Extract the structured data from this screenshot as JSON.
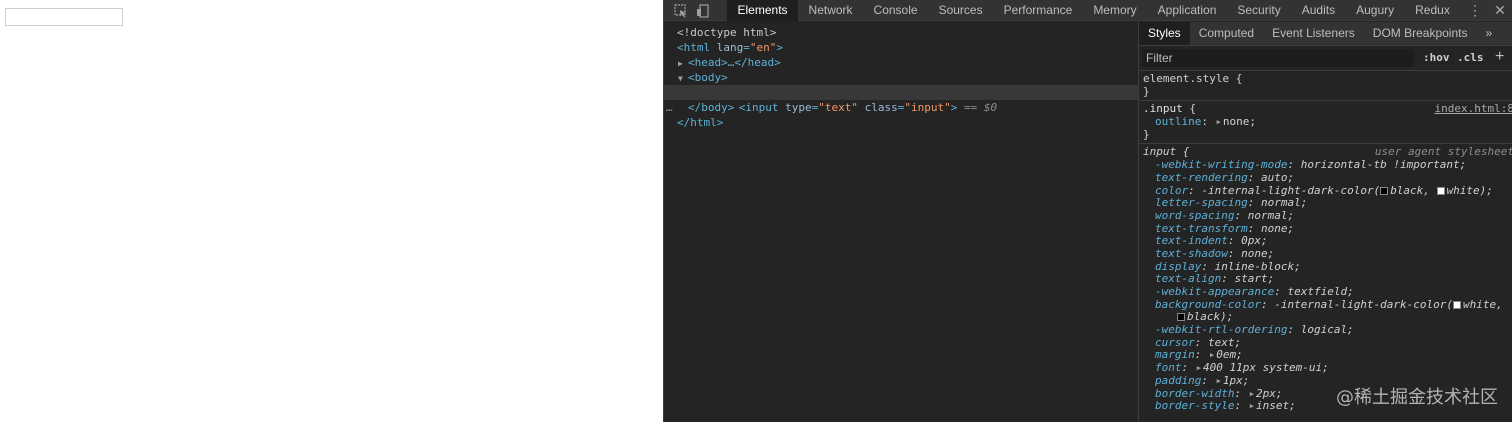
{
  "page": {
    "input_value": ""
  },
  "devtools": {
    "tabs": [
      "Elements",
      "Network",
      "Console",
      "Sources",
      "Performance",
      "Memory",
      "Application",
      "Security",
      "Audits",
      "Augury",
      "Redux"
    ],
    "active_tab": "Elements",
    "icons": {
      "inspect": "cursor-select-icon",
      "device": "device-toolbar-icon",
      "more": "kebab-menu-icon",
      "close": "close-icon"
    },
    "tree": {
      "doctype": "<!doctype html>",
      "html_open": "<html",
      "html_attr": "lang",
      "html_attr_val": "\"en\"",
      "head": "<head>…</head>",
      "body_open": "<body>",
      "input_tag": "<input",
      "input_type_attr": "type",
      "input_type_val": "\"text\"",
      "input_class_attr": "class",
      "input_class_val": "\"input\"",
      "input_close": ">",
      "eq": "==",
      "dollar": "$0",
      "body_close": "</body>",
      "html_close": "</html>",
      "dots": "…"
    },
    "styles": {
      "subtabs": [
        "Styles",
        "Computed",
        "Event Listeners",
        "DOM Breakpoints"
      ],
      "more_tabs": "»",
      "filter_placeholder": "Filter",
      "hov": ":hov",
      "cls": ".cls",
      "plus": "+",
      "element_style": "element.style {",
      "close_brace": "}",
      "input_rule": {
        "selector": ".input",
        "open": "{",
        "source": "index.html:8",
        "prop": "outline",
        "value": "none;"
      },
      "ua_rule": {
        "selector": "input",
        "open": "{",
        "source": "user agent stylesheet",
        "props": [
          {
            "name": "-webkit-writing-mode",
            "value": "horizontal-tb !important;"
          },
          {
            "name": "text-rendering",
            "value": "auto;"
          },
          {
            "name": "color",
            "value_pre": "-internal-light-dark-color(",
            "value_a": "black,",
            "value_b": "white);"
          },
          {
            "name": "letter-spacing",
            "value": "normal;"
          },
          {
            "name": "word-spacing",
            "value": "normal;"
          },
          {
            "name": "text-transform",
            "value": "none;"
          },
          {
            "name": "text-indent",
            "value": "0px;"
          },
          {
            "name": "text-shadow",
            "value": "none;"
          },
          {
            "name": "display",
            "value": "inline-block;"
          },
          {
            "name": "text-align",
            "value": "start;"
          },
          {
            "name": "-webkit-appearance",
            "value": "textfield;"
          },
          {
            "name": "background-color",
            "value_pre": "-internal-light-dark-color(",
            "value_a": "white,",
            "value_b": "black);"
          },
          {
            "name": "-webkit-rtl-ordering",
            "value": "logical;"
          },
          {
            "name": "cursor",
            "value": "text;"
          },
          {
            "name": "margin",
            "value": "0em;"
          },
          {
            "name": "font",
            "value": "400 11px system-ui;"
          },
          {
            "name": "padding",
            "value": "1px;"
          },
          {
            "name": "border-width",
            "value": "2px;"
          },
          {
            "name": "border-style",
            "value": "inset;"
          }
        ]
      }
    }
  },
  "watermark": "@稀土掘金技术社区",
  "colors": {
    "panel_bg": "#242424",
    "tag": "#5db0d7",
    "attr_value": "#f29766",
    "selected_row": "#383838"
  }
}
